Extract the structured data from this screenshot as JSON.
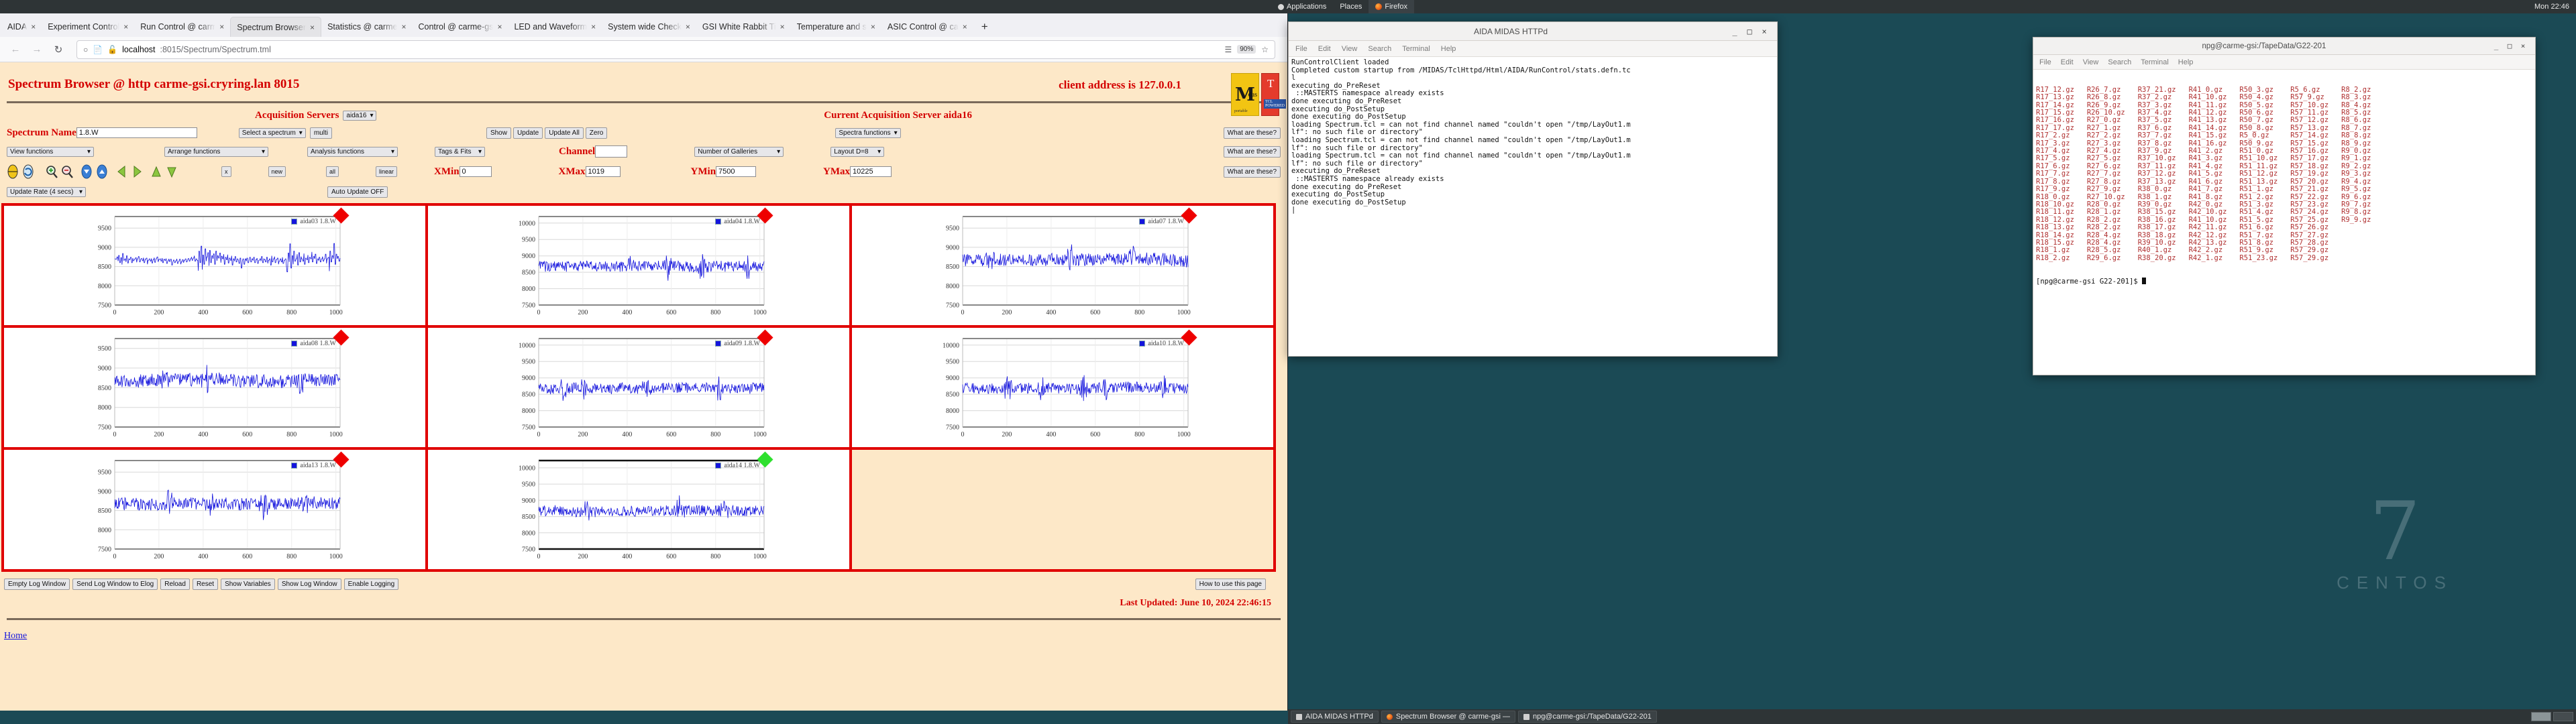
{
  "gnome_panel": {
    "applications": "Applications",
    "places": "Places",
    "firefox": "Firefox",
    "clock": "Mon 22:46"
  },
  "desktop": {
    "logo_number": "7",
    "logo_word": "CENTOS"
  },
  "browser": {
    "tabs": [
      {
        "label": "AIDA",
        "selected": false
      },
      {
        "label": "Experiment Control",
        "selected": false
      },
      {
        "label": "Run Control @ carme",
        "selected": false
      },
      {
        "label": "Spectrum Browser",
        "selected": true
      },
      {
        "label": "Statistics @ carme",
        "selected": false
      },
      {
        "label": "Control @ carme-gsi",
        "selected": false
      },
      {
        "label": "LED and Waveform",
        "selected": false
      },
      {
        "label": "System wide Check",
        "selected": false
      },
      {
        "label": "GSI White Rabbit Ti",
        "selected": false
      },
      {
        "label": "Temperature and s",
        "selected": false
      },
      {
        "label": "ASIC Control @ ca",
        "selected": false
      }
    ],
    "new_tab_label": "+",
    "close_glyph": "×",
    "nav": {
      "back": "←",
      "forward": "→",
      "reload": "↻"
    },
    "url": {
      "host": "localhost",
      "path": ":8015/Spectrum/Spectrum.tml",
      "zoom": "90%"
    }
  },
  "page": {
    "title": "Spectrum Browser @ http carme-gsi.cryring.lan 8015",
    "client_address": "client address is 127.0.0.1",
    "logo_midas": "M",
    "logo_midas_sub": "das",
    "logo_midas_small": "portable",
    "logo_tcl_t": "T",
    "logo_tcl_sub": "TCL POWERED",
    "acquisition_servers_label": "Acquisition Servers",
    "acquisition_server_value": "aida16",
    "current_server": "Current Acquisition Server aida16",
    "controls": {
      "spectrum_name_label": "Spectrum Name",
      "spectrum_name_value": "1.8.W",
      "select_spectrum": "Select a spectrum",
      "multi": "multi",
      "show": "Show",
      "update": "Update",
      "update_all": "Update All",
      "zero": "Zero",
      "spectra_functions": "Spectra functions",
      "what_are_these": "What are these?",
      "view_functions": "View functions",
      "arrange_functions": "Arrange functions",
      "analysis_functions": "Analysis functions",
      "tags_fits": "Tags & Fits",
      "channel_label": "Channel",
      "channel_value": "",
      "number_of_galleries": "Number of Galleries",
      "layout": "Layout D=8",
      "x_btn": "x",
      "new_btn": "new",
      "all_btn": "all",
      "linear_btn": "linear",
      "xmin_label": "XMin",
      "xmin_value": "0",
      "xmax_label": "XMax",
      "xmax_value": "1019",
      "ymin_label": "YMin",
      "ymin_value": "7500",
      "ymax_label": "YMax",
      "ymax_value": "10225",
      "update_rate": "Update Rate (4 secs)",
      "auto_update": "Auto Update OFF"
    },
    "footer_buttons": [
      "Empty Log Window",
      "Send Log Window to Elog",
      "Reload",
      "Reset",
      "Show Variables",
      "Show Log Window",
      "Enable Logging"
    ],
    "how_to_use": "How to use this page",
    "last_updated": "Last Updated: June 10, 2024 22:46:15",
    "home_link": "Home"
  },
  "chart_data": [
    {
      "type": "line",
      "title": "aida03 1.8.W",
      "series": [
        {
          "name": "aida03 1.8.W",
          "color": "#1414dd",
          "values": [
            8700,
            8690,
            8750,
            8640,
            8790,
            8600,
            8730,
            8550,
            8840,
            8660,
            8700,
            8620,
            8780,
            8590,
            8700,
            8680,
            8740,
            8600,
            8720,
            8650,
            8690,
            8730,
            8610,
            8700,
            8760,
            8620,
            8690,
            8710,
            8650,
            8730,
            8600,
            8690,
            8720,
            8560,
            8660,
            8700,
            8640,
            8710,
            8590,
            8680,
            8730,
            8610,
            8700,
            8750,
            8620,
            8680,
            8700,
            8640,
            8720,
            8600,
            8690,
            8660,
            8710,
            8580,
            8650,
            8700,
            8630,
            8690,
            8540,
            8620,
            8670,
            8600,
            8650,
            8700,
            8580,
            8640,
            8690,
            8560,
            8620,
            8680,
            8600,
            8660,
            8700,
            8620,
            8670,
            8710,
            8640,
            8700,
            8750,
            8660,
            8720,
            8780,
            8640,
            8700,
            8660,
            8390,
            8900,
            8600,
            9030,
            8420,
            8800,
            8560,
            8960,
            8640,
            8750,
            8860,
            8520,
            8920,
            8600,
            8780,
            8700,
            8830,
            8560,
            8900,
            8650,
            8780,
            8720,
            8850,
            8600,
            8770,
            8700,
            8820,
            8560,
            8740,
            8680,
            8810,
            8590,
            8720,
            8660,
            8780,
            8540,
            8700,
            8640,
            8760,
            8620,
            8700,
            8660,
            8580,
            8720,
            8460,
            8640,
            8700,
            8560,
            8700,
            8640,
            8720,
            8600,
            8680,
            8740,
            8620,
            8700,
            8660,
            8740,
            8600,
            8680,
            8720,
            8580,
            8660,
            8700,
            8640,
            8760,
            8600,
            8700,
            8680,
            8620,
            8740,
            8580,
            8660,
            8700,
            8540,
            8780,
            8620,
            8700,
            8760,
            8600,
            8680,
            8720,
            8560,
            8640,
            8700,
            8620,
            8740,
            8580,
            8660,
            8700,
            8500,
            8360,
            8850,
            8620,
            9090,
            8460,
            8780,
            8560,
            8900,
            8640,
            8700,
            8820,
            8540,
            8860,
            8620,
            8760,
            8700,
            8640,
            8840,
            8560,
            8720,
            8680,
            8800,
            8600,
            8740,
            8700,
            8880,
            8620,
            8760,
            8700,
            8820,
            8580,
            8700,
            8660,
            8740,
            8620,
            8700,
            8760,
            8640,
            8700,
            8820,
            8580,
            8700,
            8740,
            8380,
            8900,
            8620,
            8780,
            8700,
            9100,
            8560,
            8820,
            8700,
            8760,
            8640,
            8720
          ]
        }
      ],
      "xlabel": "",
      "ylabel": "",
      "xlim": [
        0,
        1019
      ],
      "ylim": [
        7500,
        9800
      ],
      "yticks": [
        7500,
        8000,
        8500,
        9000,
        9500
      ],
      "xticks": [
        0,
        200,
        400,
        600,
        800,
        1000
      ],
      "marker": "red-diamond"
    },
    {
      "type": "line",
      "title": "aida04 1.8.W",
      "series": [
        {
          "name": "aida04 1.8.W",
          "color": "#1414dd",
          "values": []
        }
      ],
      "xlim": [
        0,
        1019
      ],
      "ylim": [
        7500,
        10200
      ],
      "yticks": [
        7500,
        8000,
        8500,
        9000,
        9500,
        10000
      ],
      "xticks": [
        0,
        200,
        400,
        600,
        800,
        1000
      ],
      "marker": "red-diamond"
    },
    {
      "type": "line",
      "title": "aida07 1.8.W",
      "series": [
        {
          "name": "aida07 1.8.W",
          "color": "#1414dd",
          "values": []
        }
      ],
      "xlim": [
        0,
        1019
      ],
      "ylim": [
        7500,
        9800
      ],
      "yticks": [
        7500,
        8000,
        8500,
        9000,
        9500
      ],
      "xticks": [
        0,
        200,
        400,
        600,
        800,
        1000
      ],
      "marker": "red-diamond"
    },
    {
      "type": "line",
      "title": "aida08 1.8.W",
      "series": [
        {
          "name": "aida08 1.8.W",
          "color": "#1414dd",
          "values": []
        }
      ],
      "xlim": [
        0,
        1019
      ],
      "ylim": [
        7500,
        9750
      ],
      "yticks": [
        7500,
        8000,
        8500,
        9000,
        9500
      ],
      "xticks": [
        0,
        200,
        400,
        600,
        800,
        1000
      ],
      "marker": "red-diamond"
    },
    {
      "type": "line",
      "title": "aida09 1.8.W",
      "series": [
        {
          "name": "aida09 1.8.W",
          "color": "#1414dd",
          "values": []
        }
      ],
      "xlim": [
        0,
        1019
      ],
      "ylim": [
        7500,
        10200
      ],
      "yticks": [
        7500,
        8000,
        8500,
        9000,
        9500,
        10000
      ],
      "xticks": [
        0,
        200,
        400,
        600,
        800,
        1000
      ],
      "marker": "red-diamond"
    },
    {
      "type": "line",
      "title": "aida10 1.8.W",
      "series": [
        {
          "name": "aida10 1.8.W",
          "color": "#1414dd",
          "values": []
        }
      ],
      "xlim": [
        0,
        1019
      ],
      "ylim": [
        7500,
        10200
      ],
      "yticks": [
        7500,
        8000,
        8500,
        9000,
        9500,
        10000
      ],
      "xticks": [
        0,
        200,
        400,
        600,
        800,
        1000
      ],
      "marker": "red-diamond"
    },
    {
      "type": "line",
      "title": "aida13 1.8.W",
      "series": [
        {
          "name": "aida13 1.8.W",
          "color": "#1414dd",
          "values": []
        }
      ],
      "xlim": [
        0,
        1019
      ],
      "ylim": [
        7500,
        9800
      ],
      "yticks": [
        7500,
        8000,
        8500,
        9000,
        9500
      ],
      "xticks": [
        0,
        200,
        400,
        600,
        800,
        1000
      ],
      "marker": "red-diamond"
    },
    {
      "type": "line",
      "title": "aida14 1.8.W",
      "series": [
        {
          "name": "aida14 1.8.W",
          "color": "#1414dd",
          "values": []
        }
      ],
      "xlim": [
        0,
        1019
      ],
      "ylim": [
        7500,
        10225
      ],
      "yticks": [
        7500,
        8000,
        8500,
        9000,
        9500,
        10000
      ],
      "xticks": [
        0,
        200,
        400,
        600,
        800,
        1000
      ],
      "marker": "green-diamond"
    }
  ],
  "midas_terminal": {
    "title": "AIDA MIDAS HTTPd",
    "menus": [
      "File",
      "Edit",
      "View",
      "Search",
      "Terminal",
      "Help"
    ],
    "minimize": "_",
    "maximize": "□",
    "close": "×",
    "output": "RunControlClient loaded\nCompleted custom startup from /MIDAS/TclHttpd/Html/AIDA/RunControl/stats.defn.tc\nl\nexecuting do_PreReset\n ::MASTERTS namespace already exists\ndone executing do_PreReset\nexecuting do_PostSetup\ndone executing do_PostSetup\nloading Spectrum.tcl = can not find channel named \"couldn't open \"/tmp/LayOut1.m\nlf\": no such file or directory\"\nloading Spectrum.tcl = can not find channel named \"couldn't open \"/tmp/LayOut1.m\nlf\": no such file or directory\"\nloading Spectrum.tcl = can not find channel named \"couldn't open \"/tmp/LayOut1.m\nlf\": no such file or directory\"\nexecuting do_PreReset\n ::MASTERTS namespace already exists\ndone executing do_PreReset\nexecuting do_PostSetup\ndone executing do_PostSetup\n|"
  },
  "tape_terminal": {
    "title": "npg@carme-gsi:/TapeData/G22-201",
    "menus": [
      "File",
      "Edit",
      "View",
      "Search",
      "Terminal",
      "Help"
    ],
    "minimize": "_",
    "maximize": "□",
    "close": "×",
    "listing": [
      [
        "R17_12.gz",
        "R26_7.gz",
        "R37_21.gz",
        "R41_0.gz",
        "R50_3.gz",
        "R5_6.gz",
        "R8_2.gz"
      ],
      [
        "R17_13.gz",
        "R26_8.gz",
        "R37_2.gz",
        "R41_10.gz",
        "R50_4.gz",
        "R57_9.gz",
        "R8_3.gz"
      ],
      [
        "R17_14.gz",
        "R26_9.gz",
        "R37_3.gz",
        "R41_11.gz",
        "R50_5.gz",
        "R57_10.gz",
        "R8_4.gz"
      ],
      [
        "R17_15.gz",
        "R26_10.gz",
        "R37_4.gz",
        "R41_12.gz",
        "R50_6.gz",
        "R57_11.gz",
        "R8_5.gz"
      ],
      [
        "R17_16.gz",
        "R27_0.gz",
        "R37_5.gz",
        "R41_13.gz",
        "R50_7.gz",
        "R57_12.gz",
        "R8_6.gz"
      ],
      [
        "R17_17.gz",
        "R27_1.gz",
        "R37_6.gz",
        "R41_14.gz",
        "R50_8.gz",
        "R57_13.gz",
        "R8_7.gz"
      ],
      [
        "R17_2.gz",
        "R27_2.gz",
        "R37_7.gz",
        "R41_15.gz",
        "R5_0.gz",
        "R57_14.gz",
        "R8_8.gz"
      ],
      [
        "R17_3.gz",
        "R27_3.gz",
        "R37_8.gz",
        "R41_16.gz",
        "R50_9.gz",
        "R57_15.gz",
        "R8_9.gz"
      ],
      [
        "R17_4.gz",
        "R27_4.gz",
        "R37_9.gz",
        "R41_2.gz",
        "R51_0.gz",
        "R57_16.gz",
        "R9_0.gz"
      ],
      [
        "R17_5.gz",
        "R27_5.gz",
        "R37_10.gz",
        "R41_3.gz",
        "R51_10.gz",
        "R57_17.gz",
        "R9_1.gz"
      ],
      [
        "R17_6.gz",
        "R27_6.gz",
        "R37_11.gz",
        "R41_4.gz",
        "R51_11.gz",
        "R57_18.gz",
        "R9_2.gz"
      ],
      [
        "R17_7.gz",
        "R27_7.gz",
        "R37_12.gz",
        "R41_5.gz",
        "R51_12.gz",
        "R57_19.gz",
        "R9_3.gz"
      ],
      [
        "R17_8.gz",
        "R27_8.gz",
        "R37_13.gz",
        "R41_6.gz",
        "R51_13.gz",
        "R57_20.gz",
        "R9_4.gz"
      ],
      [
        "R17_9.gz",
        "R27_9.gz",
        "R38_0.gz",
        "R41_7.gz",
        "R51_1.gz",
        "R57_21.gz",
        "R9_5.gz"
      ],
      [
        "R18_0.gz",
        "R27_10.gz",
        "R38_1.gz",
        "R41_8.gz",
        "R51_2.gz",
        "R57_22.gz",
        "R9_6.gz"
      ],
      [
        "R18_10.gz",
        "R28_0.gz",
        "R39_0.gz",
        "R42_0.gz",
        "R51_3.gz",
        "R57_23.gz",
        "R9_7.gz"
      ],
      [
        "R18_11.gz",
        "R28_1.gz",
        "R38_15.gz",
        "R42_10.gz",
        "R51_4.gz",
        "R57_24.gz",
        "R9_8.gz"
      ],
      [
        "R18_12.gz",
        "R28_2.gz",
        "R38_16.gz",
        "R41_10.gz",
        "R51_5.gz",
        "R57_25.gz",
        "R9_9.gz"
      ],
      [
        "R18_13.gz",
        "R28_2.gz",
        "R38_17.gz",
        "R42_11.gz",
        "R51_6.gz",
        "R57_26.gz",
        ""
      ],
      [
        "R18_14.gz",
        "R28_4.gz",
        "R38_18.gz",
        "R42_12.gz",
        "R51_7.gz",
        "R57_27.gz",
        ""
      ],
      [
        "R18_15.gz",
        "R28_4.gz",
        "R39_10.gz",
        "R42_13.gz",
        "R51_8.gz",
        "R57_28.gz",
        ""
      ],
      [
        "R18_1.gz",
        "R28_5.gz",
        "R40_1.gz",
        "R42_2.gz",
        "R51_9.gz",
        "R57_29.gz",
        ""
      ],
      [
        "R18_2.gz",
        "R29_6.gz",
        "R38_20.gz",
        "R42_1.gz",
        "R51_23.gz",
        "R57_29.gz",
        ""
      ]
    ],
    "prompt": "[npg@carme-gsi G22-201]$ "
  },
  "taskbar": {
    "items": [
      {
        "label": "AIDA MIDAS HTTPd",
        "icon": "terminal-icon"
      },
      {
        "label": "Spectrum Browser @ carme-gsi —",
        "icon": "firefox-icon"
      },
      {
        "label": "npg@carme-gsi:/TapeData/G22-201",
        "icon": "terminal-icon"
      }
    ]
  }
}
